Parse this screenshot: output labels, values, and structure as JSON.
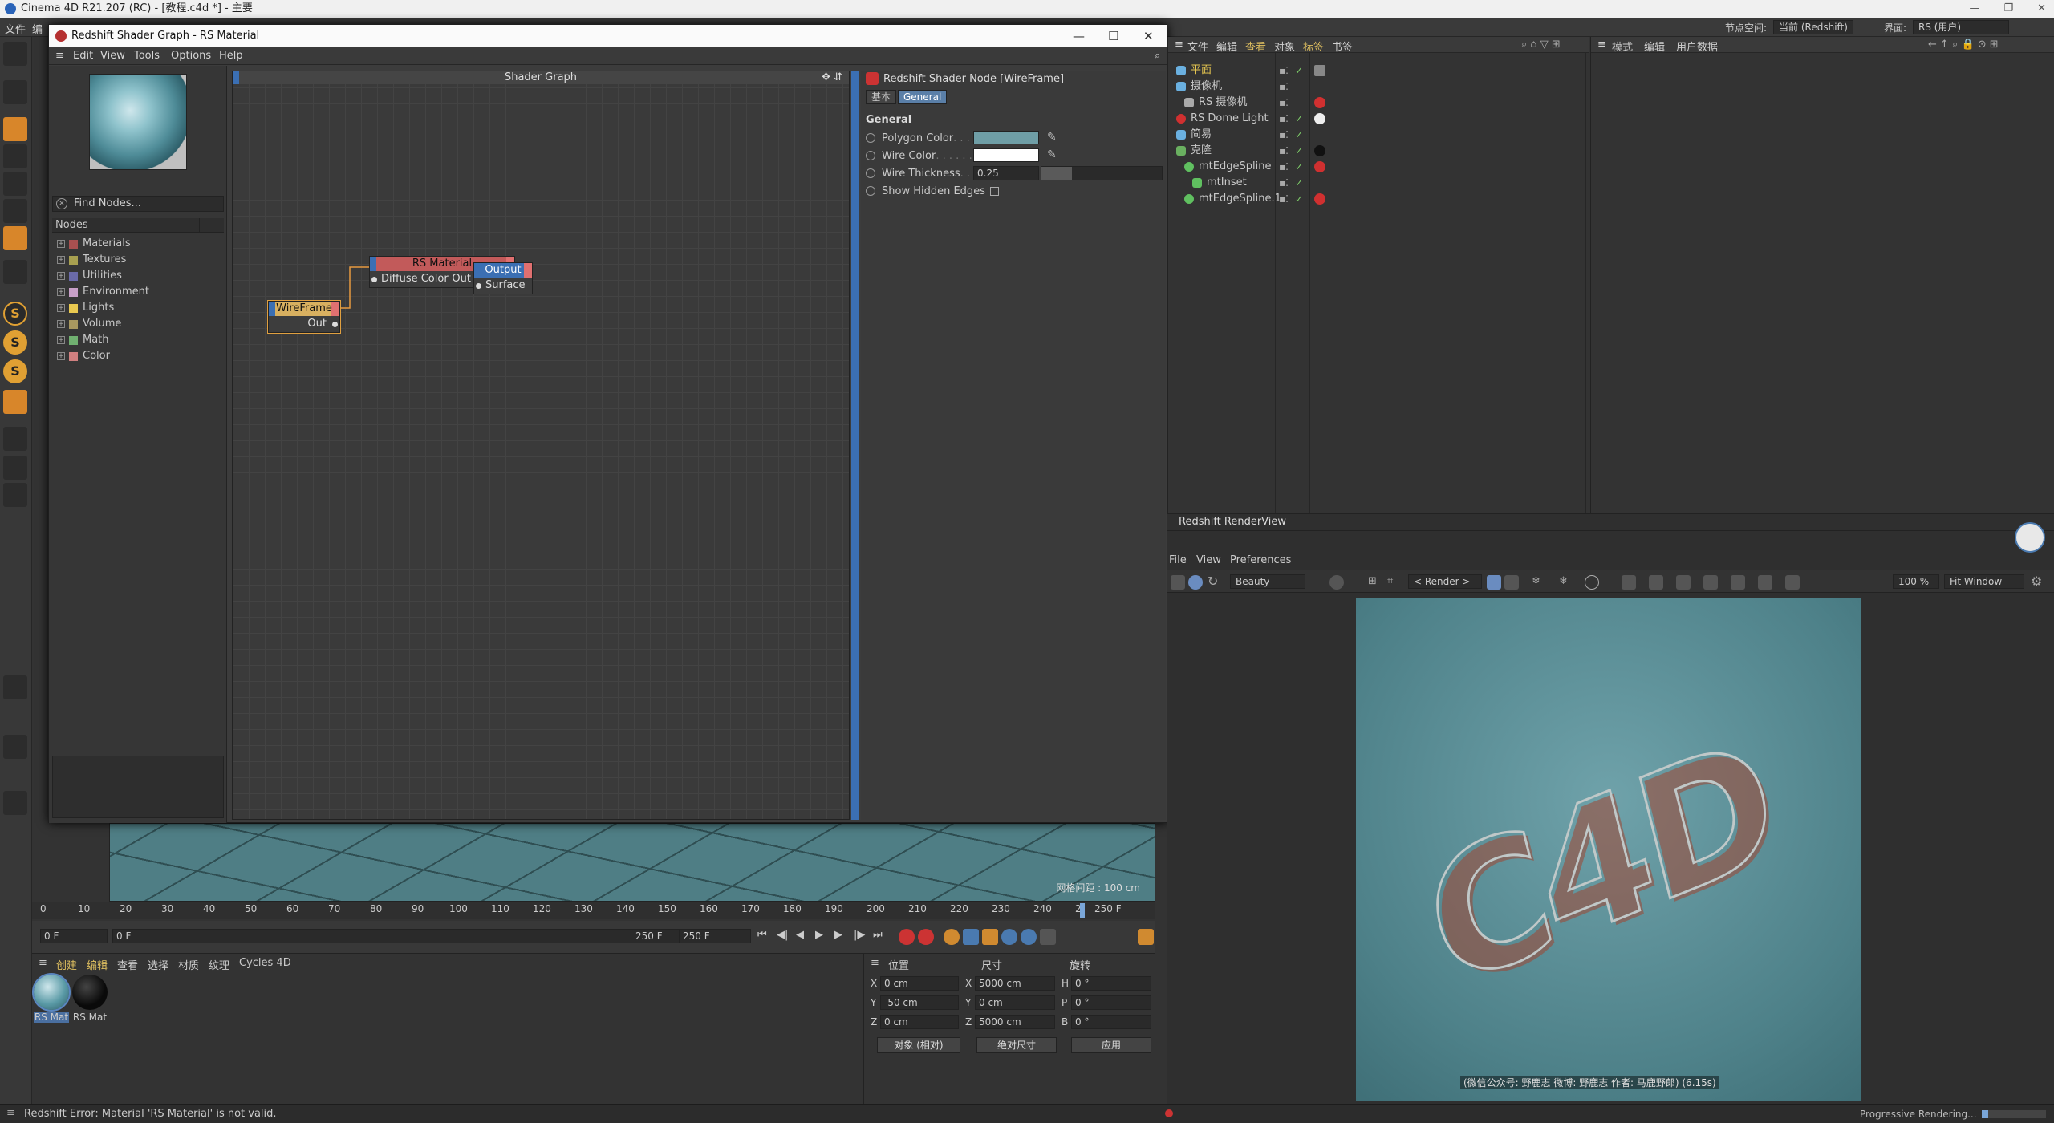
{
  "app": {
    "title": "Cinema 4D R21.207 (RC) - [教程.c4d *] - 主要",
    "node_space_label": "节点空间:",
    "node_space_value": "当前 (Redshift)",
    "layout_label": "界面:",
    "layout_value": "RS (用户)",
    "main_menu": [
      "文件",
      "编"
    ]
  },
  "shader_graph": {
    "window_title": "Redshift Shader Graph - RS Material",
    "menu": [
      "Edit",
      "View",
      "Tools",
      "Options",
      "Help"
    ],
    "find_nodes": "Find Nodes...",
    "nodes_header": "Nodes",
    "categories": [
      {
        "label": "Materials",
        "color": "#a85050"
      },
      {
        "label": "Textures",
        "color": "#a8a050"
      },
      {
        "label": "Utilities",
        "color": "#6a6aa8"
      },
      {
        "label": "Environment",
        "color": "#c8a0c8"
      },
      {
        "label": "Lights",
        "color": "#e8c850"
      },
      {
        "label": "Volume",
        "color": "#a89860"
      },
      {
        "label": "Math",
        "color": "#70b070"
      },
      {
        "label": "Color",
        "color": "#d08080"
      }
    ],
    "graph_title": "Shader Graph",
    "nodes": {
      "rs_material": {
        "title": "RS Material",
        "in": "Diffuse Color",
        "out": "Out Color"
      },
      "output": {
        "title": "Output",
        "in": "Surface"
      },
      "wireframe": {
        "title": "WireFrame",
        "out": "Out"
      }
    },
    "attributes": {
      "header": "Redshift Shader Node [WireFrame]",
      "tabs": [
        "基本",
        "General"
      ],
      "section": "General",
      "polygon_color_label": "Polygon Color",
      "polygon_color": "#6f9ea6",
      "wire_color_label": "Wire Color",
      "wire_color": "#ffffff",
      "wire_thickness_label": "Wire Thickness",
      "wire_thickness": "0.25",
      "show_hidden_edges_label": "Show Hidden Edges"
    }
  },
  "object_manager": {
    "menu": [
      "文件",
      "编辑",
      "查看",
      "对象",
      "标签",
      "书签"
    ],
    "objects": [
      {
        "name": "平面",
        "color": "#e8c850",
        "highlight": true
      },
      {
        "name": "摄像机",
        "color": "#6ab0e0"
      },
      {
        "name": "RS 摄像机",
        "color": "#aaaaaa"
      },
      {
        "name": "RS Dome Light",
        "color": "#d03030"
      },
      {
        "name": "简易",
        "color": "#6ab0e0"
      },
      {
        "name": "克隆",
        "color": "#6ab060"
      },
      {
        "name": "mtEdgeSpline",
        "color": "#60c060"
      },
      {
        "name": "mtInset",
        "color": "#60c060"
      },
      {
        "name": "mtEdgeSpline.1",
        "color": "#60c060"
      }
    ]
  },
  "attribute_manager": {
    "menu": [
      "模式",
      "编辑",
      "用户数据"
    ]
  },
  "render_view": {
    "title": "Redshift RenderView",
    "menu": [
      "File",
      "View",
      "Preferences"
    ],
    "aov": "Beauty",
    "render_label": "< Render >",
    "zoom": "100 %",
    "fit": "Fit Window",
    "watermark": "(微信公众号: 野鹿志  微博: 野鹿志  作者: 马鹿野郎) (6.15s)",
    "status": "Progressive Rendering..."
  },
  "viewport": {
    "grid_label": "网格间距 : 100 cm"
  },
  "timeline": {
    "ticks": [
      "0",
      "10",
      "20",
      "30",
      "40",
      "50",
      "60",
      "70",
      "80",
      "90",
      "100",
      "110",
      "120",
      "130",
      "140",
      "150",
      "160",
      "170",
      "180",
      "190",
      "200",
      "210",
      "220",
      "230",
      "240",
      "2"
    ],
    "end_frame": "250 F",
    "current_frame": "0 F",
    "range_start": "0 F",
    "range_end": "250 F",
    "max_frame": "250 F"
  },
  "material_manager": {
    "menu": [
      "创建",
      "编辑",
      "查看",
      "选择",
      "材质",
      "纹理",
      "Cycles 4D"
    ],
    "materials": [
      {
        "label": "RS Mat"
      },
      {
        "label": "RS Mat"
      }
    ]
  },
  "coordinates": {
    "headers": [
      "位置",
      "尺寸",
      "旋转"
    ],
    "position": {
      "x": "0 cm",
      "y": "-50 cm",
      "z": "0 cm"
    },
    "size": {
      "x": "5000 cm",
      "y": "0 cm",
      "z": "5000 cm"
    },
    "rotation": {
      "h": "0 °",
      "p": "0 °",
      "b": "0 °"
    },
    "axis_labels": {
      "x": "X",
      "y": "Y",
      "z": "Z",
      "h": "H",
      "p": "P",
      "b": "B"
    },
    "mode": "对象 (相对)",
    "size_mode": "绝对尺寸",
    "apply": "应用"
  },
  "status_bar": {
    "error": "Redshift Error: Material 'RS Material' is not valid."
  }
}
